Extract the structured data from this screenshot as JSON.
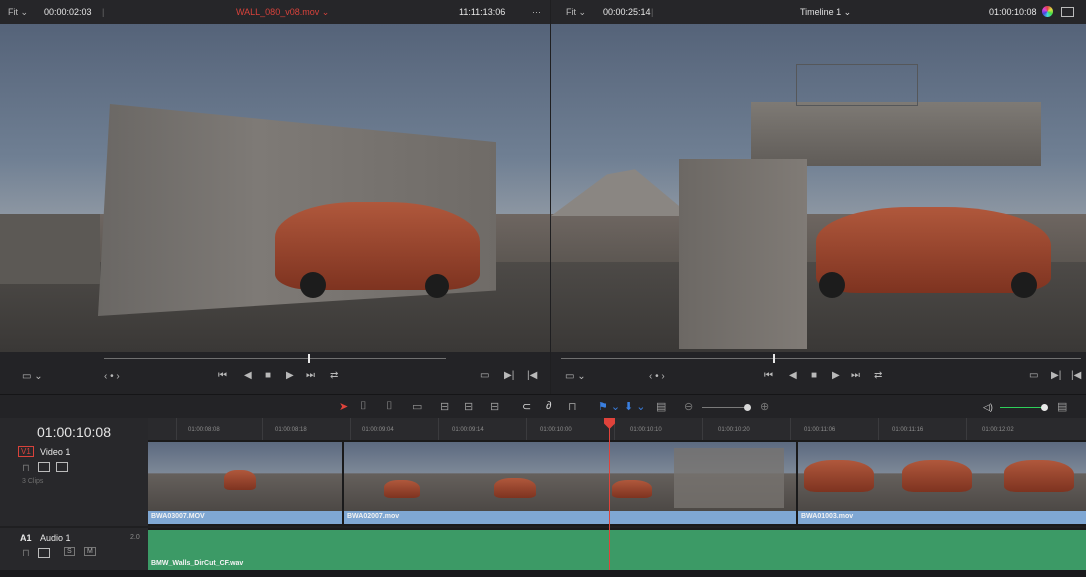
{
  "source_viewer": {
    "zoom": "Fit",
    "zoom_chevron": "⌄",
    "timecode": "00:00:02:03",
    "clip_name": "WALL_080_v08.mov ⌄",
    "duration": "11:11:13:06",
    "more": "···",
    "jog": "‹ • ›",
    "view_mode": "▭ ⌄"
  },
  "timeline_viewer": {
    "zoom": "Fit",
    "zoom_chevron": "⌄",
    "timecode": "00:00:25:14",
    "timeline_name": "Timeline 1 ⌄",
    "record_timecode": "01:00:10:08",
    "jog": "‹ • ›",
    "view_mode": "▭ ⌄"
  },
  "transport": {
    "first": "⏮",
    "prev": "◀",
    "stop": "■",
    "play": "▶",
    "last": "⏭",
    "loop": "⇄",
    "match": "▭",
    "mark_in": "▶|",
    "mark_out": "|◀"
  },
  "toolbar": {
    "select": "➤",
    "trim": "⌷",
    "dynamic_trim": "⌷",
    "blade": "▭",
    "insert": "⊟",
    "overwrite": "⊟",
    "replace": "⊟",
    "snapping": "⊂",
    "link": "∂",
    "lock": "⊓",
    "flag": "⚑ ⌄",
    "marker": "⬇ ⌄",
    "view": "▤",
    "zoom_out": "⊖",
    "zoom_in": "⊕",
    "volume": "◁)",
    "meter": "▤"
  },
  "timeline": {
    "current_timecode": "01:00:10:08",
    "ruler": [
      "01:00:08:08",
      "01:00:08:18",
      "01:00:09:04",
      "01:00:09:14",
      "01:00:10:00",
      "01:00:10:10",
      "01:00:10:20",
      "01:00:11:06",
      "01:00:11:16",
      "01:00:12:02"
    ],
    "video_track": {
      "id": "V1",
      "name": "Video 1",
      "clips_count": "3 Clips",
      "clips": [
        "BWA03007.MOV",
        "BWA02007.mov",
        "BWA01003.mov"
      ]
    },
    "audio_track": {
      "id": "A1",
      "name": "Audio 1",
      "channels": "2.0",
      "solo": "S",
      "mute": "M",
      "clip": "BMW_Walls_DirCut_CF.wav"
    }
  },
  "colors": {
    "clip_name_red": "#d9423b",
    "playhead_red": "#e0433b",
    "video_clip_blue": "#7fa7d3",
    "audio_clip_green": "#3c9a66",
    "volume_slider_green": "#2ecf5a"
  }
}
